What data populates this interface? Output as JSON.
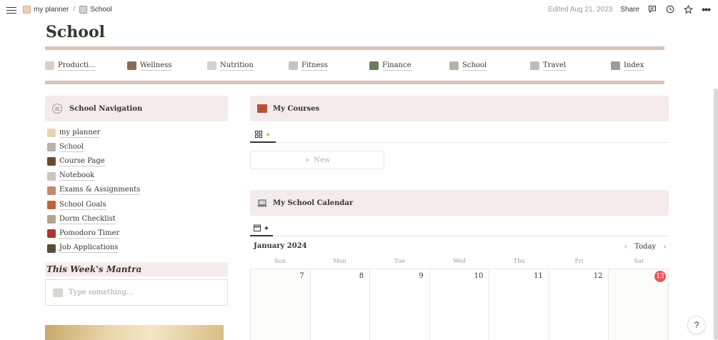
{
  "topbar": {
    "breadcrumbs": [
      "my planner",
      "School"
    ],
    "separator": "/",
    "edited": "Edited Aug 21, 2023",
    "share": "Share"
  },
  "page": {
    "title": "School"
  },
  "nav_strip": [
    {
      "label": "Producti...",
      "icon": "productivity-icon"
    },
    {
      "label": "Wellness",
      "icon": "wellness-icon"
    },
    {
      "label": "Nutrition",
      "icon": "nutrition-icon"
    },
    {
      "label": "Fitness",
      "icon": "fitness-icon"
    },
    {
      "label": "Finance",
      "icon": "finance-icon"
    },
    {
      "label": "School",
      "icon": "school-icon"
    },
    {
      "label": "Travel",
      "icon": "travel-icon"
    },
    {
      "label": "Index",
      "icon": "index-icon"
    }
  ],
  "school_navigation": {
    "title": "School Navigation",
    "links": [
      {
        "label": "my planner",
        "icon": "planner-icon"
      },
      {
        "label": "School",
        "icon": "school-icon"
      },
      {
        "label": "Course Page",
        "icon": "course-icon"
      },
      {
        "label": "Notebook",
        "icon": "notebook-icon"
      },
      {
        "label": "Exams & Assignments",
        "icon": "exam-icon"
      },
      {
        "label": "School Goals",
        "icon": "goal-icon"
      },
      {
        "label": "Dorm Checklist",
        "icon": "dorm-icon"
      },
      {
        "label": "Pomodoro Timer",
        "icon": "timer-icon"
      },
      {
        "label": "Job Applications",
        "icon": "job-icon"
      }
    ]
  },
  "mantra": {
    "title": "This Week's Mantra",
    "placeholder": "Type something..."
  },
  "courses": {
    "title": "My Courses",
    "new_label": "New",
    "new_plus": "+"
  },
  "calendar": {
    "title": "My School Calendar",
    "month": "January 2024",
    "today_label": "Today",
    "prev": "‹",
    "next": "›",
    "weekdays": [
      "Sun",
      "Mon",
      "Tue",
      "Wed",
      "Thu",
      "Fri",
      "Sat"
    ],
    "days": [
      "7",
      "8",
      "9",
      "10",
      "11",
      "12",
      "13"
    ],
    "today_day": "13"
  },
  "help": {
    "label": "?"
  },
  "colors": {
    "accent_bar": "#d8c4b8",
    "callout_bg": "#f3ecea",
    "today_red": "#eb5757"
  }
}
